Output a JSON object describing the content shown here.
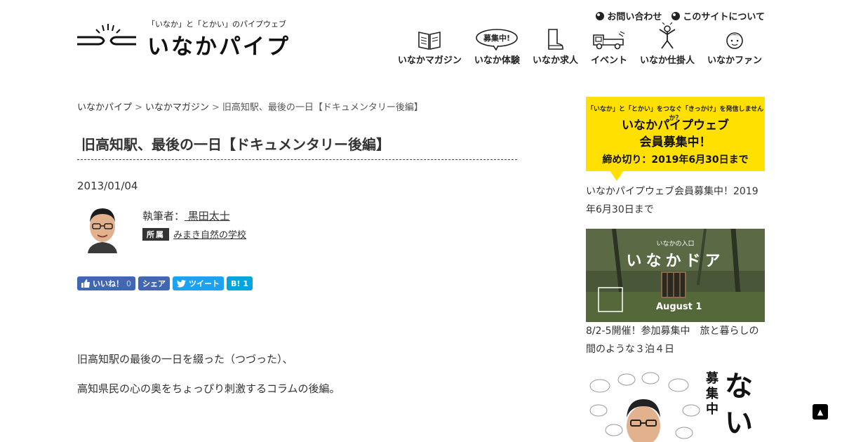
{
  "header": {
    "tagline": "「いなか」と「とかい」のパイプウェブ",
    "site_name": "いなかパイプ",
    "util_links": [
      {
        "label": "お問い合わせ"
      },
      {
        "label": "このサイトについて"
      }
    ],
    "nav": [
      {
        "label": "いなかマガジン",
        "icon": "magazine-icon"
      },
      {
        "label": "いなか体験",
        "icon": "speech-bubble-icon",
        "bubble_text": "募集中!"
      },
      {
        "label": "いなか求人",
        "icon": "boot-icon"
      },
      {
        "label": "イベント",
        "icon": "truck-icon"
      },
      {
        "label": "いなか仕掛人",
        "icon": "person-icon"
      },
      {
        "label": "いなかファン",
        "icon": "face-icon"
      }
    ]
  },
  "breadcrumb": {
    "items": [
      "いなかパイプ",
      "いなかマガジン"
    ],
    "separator": ">",
    "current": "旧高知駅、最後の一日【ドキュメンタリー後編】"
  },
  "article": {
    "title": "旧高知駅、最後の一日【ドキュメンタリー後編】",
    "date": "2013/01/04",
    "author_prefix": "執筆者：",
    "author_name": " 黒田太士",
    "affiliation_label": "所属",
    "affiliation": "みまき自然の学校",
    "paragraphs": [
      "旧高知駅の最後の一日を綴った（つづった）、",
      "高知県民の心の奥をちょっぴり刺激するコラムの後編。"
    ]
  },
  "share": {
    "facebook_like": "いいね！",
    "facebook_count": "0",
    "facebook_share": "シェア",
    "tweet": "ツイート",
    "hatena_label": "B!",
    "hatena_count": "1"
  },
  "sidebar": {
    "banner1": {
      "small": "「いなか」と「とかい」をつなぐ「きっかけ」を発信しませんか？",
      "line1": "いなかパイプウェブ",
      "line2": "会員募集中！",
      "line3": "締め切り：2019年6月30日まで"
    },
    "caption1": "いなかパイプウェブ会員募集中！2019年6月30日まで",
    "banner2": {
      "small": "いなかの入口",
      "big": "いなかドア",
      "date": "August 1"
    },
    "caption2": "8/2-5開催！参加募集中　旅と暮らしの間のような３泊４日",
    "banner3": {
      "vertical1": "募集中",
      "vertical2": "ない"
    }
  },
  "page_top": "▲",
  "colors": {
    "facebook": "#4267b2",
    "twitter": "#1da1f2",
    "hatena": "#00a4de",
    "banner_yellow": "#ffe000",
    "text": "#333333"
  }
}
